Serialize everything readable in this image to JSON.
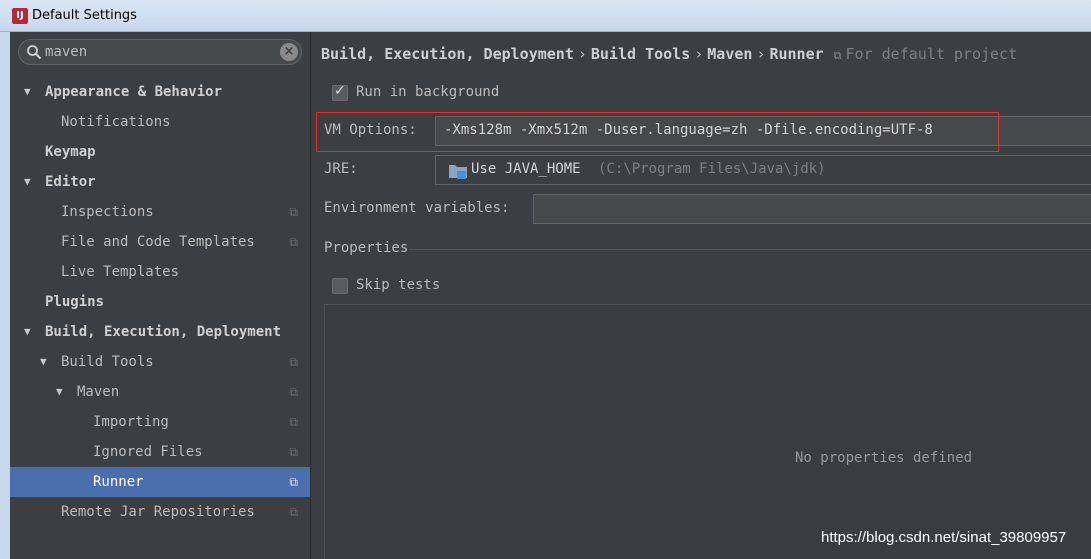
{
  "window": {
    "title": "Default Settings",
    "icon": "intellij-app-icon"
  },
  "search": {
    "value": "maven",
    "icon": "search-icon",
    "clear_icon": "clear-search-icon"
  },
  "tree": [
    {
      "label": "Appearance & Behavior",
      "expanded": true
    },
    {
      "label": "Notifications"
    },
    {
      "label": "Keymap"
    },
    {
      "label": "Editor",
      "expanded": true
    },
    {
      "label": "Inspections",
      "copy_icon": true
    },
    {
      "label": "File and Code Templates",
      "copy_icon": true
    },
    {
      "label": "Live Templates"
    },
    {
      "label": "Plugins"
    },
    {
      "label": "Build, Execution, Deployment",
      "expanded": true
    },
    {
      "label": "Build Tools",
      "expanded": true,
      "copy_icon": true
    },
    {
      "label": "Maven",
      "expanded": true,
      "copy_icon": true
    },
    {
      "label": "Importing",
      "copy_icon": true
    },
    {
      "label": "Ignored Files",
      "copy_icon": true
    },
    {
      "label": "Runner",
      "selected": true,
      "copy_icon": true
    },
    {
      "label": "Remote Jar Repositories",
      "copy_icon": true
    }
  ],
  "breadcrumb": {
    "items": [
      "Build, Execution, Deployment",
      "Build Tools",
      "Maven",
      "Runner"
    ],
    "separator": "›",
    "project_note": "For default project"
  },
  "runner": {
    "run_in_background": {
      "label": "Run in background",
      "checked": true
    },
    "vm_options": {
      "label": "VM Options:",
      "value": "-Xms128m -Xmx512m -Duser.language=zh -Dfile.encoding=UTF-8"
    },
    "jre": {
      "label": "JRE:",
      "value": "Use JAVA_HOME",
      "detail": "(C:\\Program Files\\Java\\jdk)"
    },
    "env_vars": {
      "label": "Environment variables:",
      "value": ""
    },
    "properties": {
      "label": "Properties",
      "empty_text": "No properties defined"
    },
    "skip_tests": {
      "label": "Skip tests",
      "checked": false
    }
  },
  "watermark": "https://blog.csdn.net/sinat_39809957",
  "colors": {
    "selection": "#4b6eaf",
    "highlight_box": "#e5312e",
    "background": "#3c3f41"
  }
}
